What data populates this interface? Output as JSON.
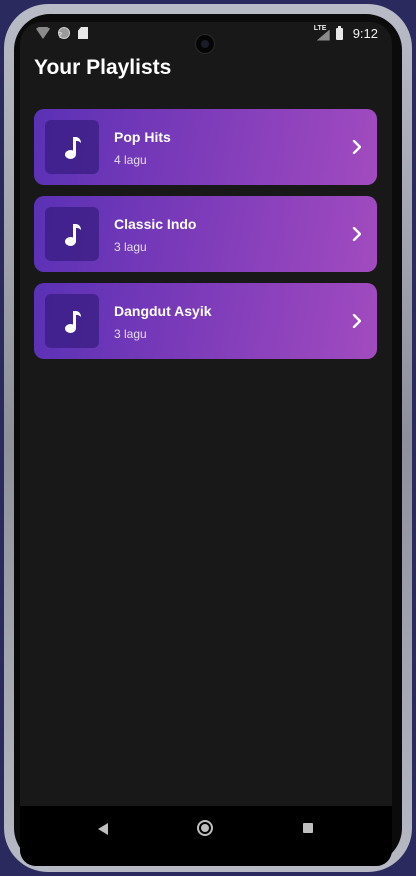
{
  "status_bar": {
    "time": "9:12",
    "network_label": "LTE",
    "wifi_badge": "?",
    "icons": [
      "wifi-icon",
      "sync-icon",
      "sd-card-icon",
      "signal-icon",
      "battery-icon"
    ]
  },
  "page": {
    "title": "Your Playlists"
  },
  "playlists": [
    {
      "name": "Pop Hits",
      "count": "4 lagu",
      "icon": "music-note-icon"
    },
    {
      "name": "Classic Indo",
      "count": "3 lagu",
      "icon": "music-note-icon"
    },
    {
      "name": "Dangdut Asyik",
      "count": "3 lagu",
      "icon": "music-note-icon"
    }
  ],
  "colors": {
    "background": "#181818",
    "card_gradient_start": "#5a31b5",
    "card_gradient_end": "#a24bbf",
    "text_primary": "#ffffff"
  },
  "nav_bar": {
    "icons": [
      "back-icon",
      "home-icon",
      "recents-icon"
    ]
  }
}
